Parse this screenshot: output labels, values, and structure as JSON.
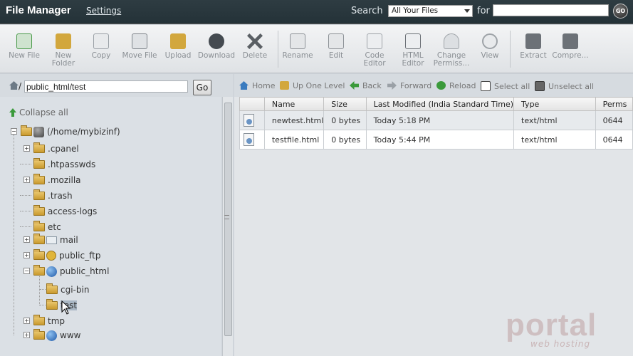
{
  "header": {
    "title": "File Manager",
    "settings": "Settings",
    "search_label": "Search",
    "search_scope": "All Your Files",
    "for_label": "for",
    "search_value": "",
    "go": "GO"
  },
  "toolbar": [
    {
      "label": "New File",
      "icon": "new-file-icon",
      "color": "#4a9a4a"
    },
    {
      "label": "New Folder",
      "icon": "new-folder-icon",
      "color": "#d2a73d"
    },
    {
      "label": "Copy",
      "icon": "copy-icon",
      "color": "#9aa0a6"
    },
    {
      "label": "Move File",
      "icon": "move-file-icon",
      "color": "#7d8389"
    },
    {
      "label": "Upload",
      "icon": "upload-icon",
      "color": "#d2a73d"
    },
    {
      "label": "Download",
      "icon": "download-icon",
      "color": "#444a50"
    },
    {
      "label": "Delete",
      "icon": "delete-icon",
      "color": "#5a5f64"
    },
    {
      "label": "Rename",
      "icon": "rename-icon",
      "color": "#8c9196"
    },
    {
      "label": "Edit",
      "icon": "edit-icon",
      "color": "#8c9196"
    },
    {
      "label": "Code Editor",
      "icon": "code-editor-icon",
      "color": "#9ea3a8"
    },
    {
      "label": "HTML Editor",
      "icon": "html-editor-icon",
      "color": "#6c7177"
    },
    {
      "label": "Change Permiss...",
      "icon": "change-permissions-icon",
      "color": "#9ea3a8"
    },
    {
      "label": "View",
      "icon": "view-icon",
      "color": "#9ea3a8"
    },
    {
      "label": "Extract",
      "icon": "extract-icon",
      "color": "#6c7177"
    },
    {
      "label": "Compre...",
      "icon": "compress-icon",
      "color": "#6c7177"
    }
  ],
  "path": {
    "prefix": "/",
    "value": "public_html/test",
    "go": "Go"
  },
  "nav": {
    "home": "Home",
    "up": "Up One Level",
    "back": "Back",
    "forward": "Forward",
    "reload": "Reload",
    "select_all": "Select all",
    "unselect_all": "Unselect all"
  },
  "tree": {
    "collapse": "Collapse all",
    "root": "(/home/mybizinf)",
    "items": [
      {
        "label": ".cpanel"
      },
      {
        "label": ".htpasswds"
      },
      {
        "label": ".mozilla"
      },
      {
        "label": ".trash"
      },
      {
        "label": "access-logs"
      },
      {
        "label": "etc"
      },
      {
        "label": "mail"
      },
      {
        "label": "public_ftp"
      },
      {
        "label": "public_html"
      },
      {
        "label": "cgi-bin"
      },
      {
        "label": "test"
      },
      {
        "label": "tmp"
      },
      {
        "label": "www"
      }
    ]
  },
  "table": {
    "columns": [
      "",
      "Name",
      "Size",
      "Last Modified (India Standard Time)",
      "Type",
      "Perms"
    ],
    "rows": [
      {
        "name": "newtest.html",
        "size": "0 bytes",
        "modified": "Today 5:18 PM",
        "type": "text/html",
        "perms": "0644"
      },
      {
        "name": "testfile.html",
        "size": "0 bytes",
        "modified": "Today 5:44 PM",
        "type": "text/html",
        "perms": "0644"
      }
    ]
  },
  "watermark": {
    "main": "portal",
    "sub": "web hosting"
  }
}
